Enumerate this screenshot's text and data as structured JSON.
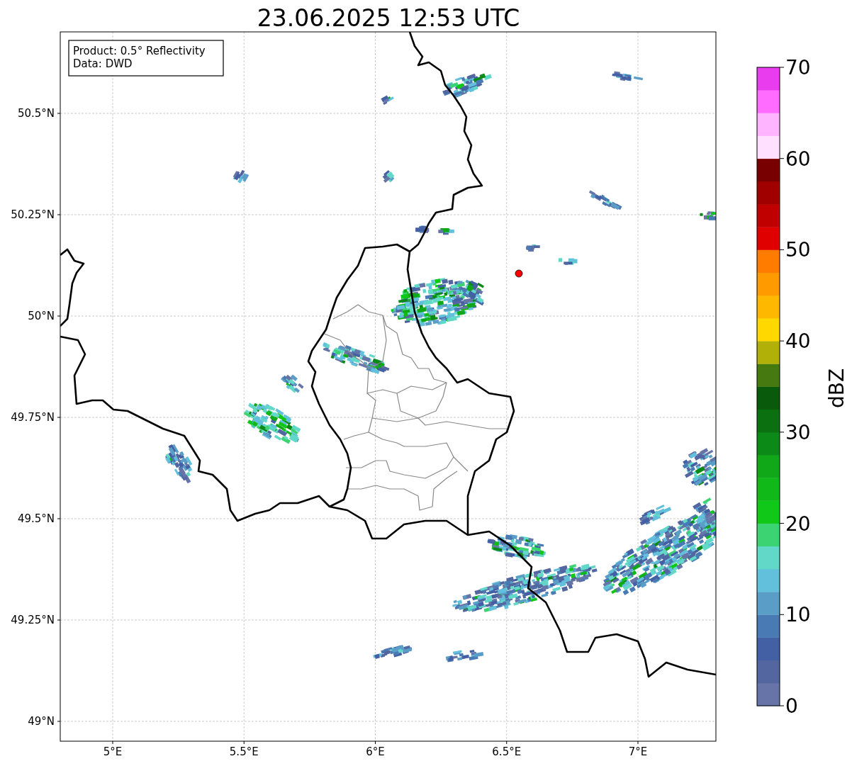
{
  "title": "23.06.2025 12:53 UTC",
  "info_box": [
    "Product: 0.5° Reflectivity",
    "Data: DWD"
  ],
  "map": {
    "x_tick_labels": [
      "5°E",
      "5.5°E",
      "6°E",
      "6.5°E",
      "7°E"
    ],
    "y_tick_labels": [
      "50.5°N",
      "50.25°N",
      "50°N",
      "49.75°N",
      "49.5°N",
      "49.25°N",
      "49°N"
    ]
  },
  "colorbar": {
    "label": "dBZ",
    "tick_labels": [
      "70",
      "60",
      "50",
      "40",
      "30",
      "20",
      "10",
      "0"
    ],
    "bands": [
      {
        "color": "#6674a8"
      },
      {
        "color": "#5366a0"
      },
      {
        "color": "#4460a4"
      },
      {
        "color": "#4a7ab4"
      },
      {
        "color": "#5a9ec8"
      },
      {
        "color": "#62c0dc"
      },
      {
        "color": "#62d8c8"
      },
      {
        "color": "#3cd472"
      },
      {
        "color": "#10c818"
      },
      {
        "color": "#10b818"
      },
      {
        "color": "#10a818"
      },
      {
        "color": "#0c8a18"
      },
      {
        "color": "#0a7010"
      },
      {
        "color": "#0a5a0c"
      },
      {
        "color": "#467a10"
      },
      {
        "color": "#b0b008"
      },
      {
        "color": "#ffd800"
      },
      {
        "color": "#ffb800"
      },
      {
        "color": "#ff9a00"
      },
      {
        "color": "#ff7c00"
      },
      {
        "color": "#e00000"
      },
      {
        "color": "#c00000"
      },
      {
        "color": "#a00000"
      },
      {
        "color": "#780000"
      },
      {
        "color": "#ffe0ff"
      },
      {
        "color": "#ffb4ff"
      },
      {
        "color": "#ff6cff"
      },
      {
        "color": "#e83cee"
      }
    ]
  }
}
